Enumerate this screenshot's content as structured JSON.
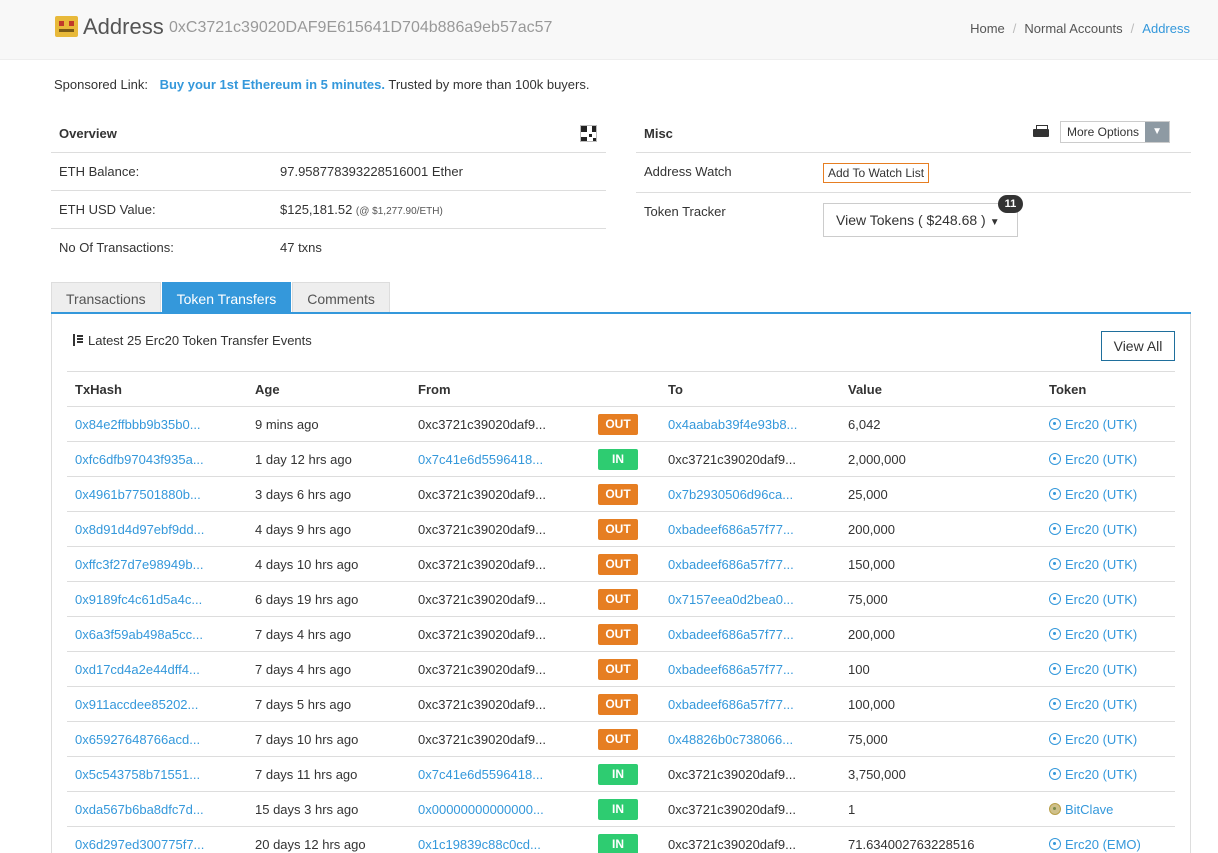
{
  "header": {
    "title": "Address",
    "address": "0xC3721c39020DAF9E615641D704b886a9eb57ac57",
    "breadcrumb": [
      "Home",
      "Normal Accounts",
      "Address"
    ]
  },
  "sponsored": {
    "label": "Sponsored Link:",
    "link": "Buy your 1st Ethereum in 5 minutes.",
    "text": "Trusted by more than 100k buyers."
  },
  "overview": {
    "title": "Overview",
    "balance_label": "ETH Balance:",
    "balance_value": "97.958778393228516001 Ether",
    "usd_label": "ETH USD Value:",
    "usd_value": "$125,181.52",
    "usd_rate": "(@ $1,277.90/ETH)",
    "txn_label": "No Of Transactions:",
    "txn_value": "47 txns"
  },
  "misc": {
    "title": "Misc",
    "more_options": "More Options",
    "watch_label": "Address Watch",
    "watch_button": "Add To Watch List",
    "tracker_label": "Token Tracker",
    "tokens_button": "View Tokens ( $248.68 )",
    "token_count": "11"
  },
  "tabs": [
    "Transactions",
    "Token Transfers",
    "Comments"
  ],
  "events": {
    "title": "Latest 25 Erc20 Token Transfer Events",
    "view_all": "View All",
    "columns": [
      "TxHash",
      "Age",
      "From",
      "",
      "To",
      "Value",
      "Token"
    ],
    "rows": [
      {
        "hash": "0x84e2ffbbb9b35b0...",
        "age": "9 mins ago",
        "from": "0xc3721c39020daf9...",
        "dir": "OUT",
        "to": "0x4aabab39f4e93b8...",
        "value": "6,042",
        "token": "Erc20 (UTK)"
      },
      {
        "hash": "0xfc6dfb97043f935a...",
        "age": "1 day 12 hrs ago",
        "from": "0x7c41e6d5596418...",
        "dir": "IN",
        "to": "0xc3721c39020daf9...",
        "value": "2,000,000",
        "token": "Erc20 (UTK)"
      },
      {
        "hash": "0x4961b77501880b...",
        "age": "3 days 6 hrs ago",
        "from": "0xc3721c39020daf9...",
        "dir": "OUT",
        "to": "0x7b2930506d96ca...",
        "value": "25,000",
        "token": "Erc20 (UTK)"
      },
      {
        "hash": "0x8d91d4d97ebf9dd...",
        "age": "4 days 9 hrs ago",
        "from": "0xc3721c39020daf9...",
        "dir": "OUT",
        "to": "0xbadeef686a57f77...",
        "value": "200,000",
        "token": "Erc20 (UTK)"
      },
      {
        "hash": "0xffc3f27d7e98949b...",
        "age": "4 days 10 hrs ago",
        "from": "0xc3721c39020daf9...",
        "dir": "OUT",
        "to": "0xbadeef686a57f77...",
        "value": "150,000",
        "token": "Erc20 (UTK)"
      },
      {
        "hash": "0x9189fc4c61d5a4c...",
        "age": "6 days 19 hrs ago",
        "from": "0xc3721c39020daf9...",
        "dir": "OUT",
        "to": "0x7157eea0d2bea0...",
        "value": "75,000",
        "token": "Erc20 (UTK)"
      },
      {
        "hash": "0x6a3f59ab498a5cc...",
        "age": "7 days 4 hrs ago",
        "from": "0xc3721c39020daf9...",
        "dir": "OUT",
        "to": "0xbadeef686a57f77...",
        "value": "200,000",
        "token": "Erc20 (UTK)"
      },
      {
        "hash": "0xd17cd4a2e44dff4...",
        "age": "7 days 4 hrs ago",
        "from": "0xc3721c39020daf9...",
        "dir": "OUT",
        "to": "0xbadeef686a57f77...",
        "value": "100",
        "token": "Erc20 (UTK)"
      },
      {
        "hash": "0x911accdee85202...",
        "age": "7 days 5 hrs ago",
        "from": "0xc3721c39020daf9...",
        "dir": "OUT",
        "to": "0xbadeef686a57f77...",
        "value": "100,000",
        "token": "Erc20 (UTK)"
      },
      {
        "hash": "0x65927648766acd...",
        "age": "7 days 10 hrs ago",
        "from": "0xc3721c39020daf9...",
        "dir": "OUT",
        "to": "0x48826b0c738066...",
        "value": "75,000",
        "token": "Erc20 (UTK)"
      },
      {
        "hash": "0x5c543758b71551...",
        "age": "7 days 11 hrs ago",
        "from": "0x7c41e6d5596418...",
        "dir": "IN",
        "to": "0xc3721c39020daf9...",
        "value": "3,750,000",
        "token": "Erc20 (UTK)"
      },
      {
        "hash": "0xda567b6ba8dfc7d...",
        "age": "15 days 3 hrs ago",
        "from": "0x00000000000000...",
        "dir": "IN",
        "to": "0xc3721c39020daf9...",
        "value": "1",
        "token": "BitClave"
      },
      {
        "hash": "0x6d297ed300775f7...",
        "age": "20 days 12 hrs ago",
        "from": "0x1c19839c88c0cd...",
        "dir": "IN",
        "to": "0xc3721c39020daf9...",
        "value": "71.634002763228516",
        "token": "Erc20 (EMO)"
      }
    ]
  }
}
